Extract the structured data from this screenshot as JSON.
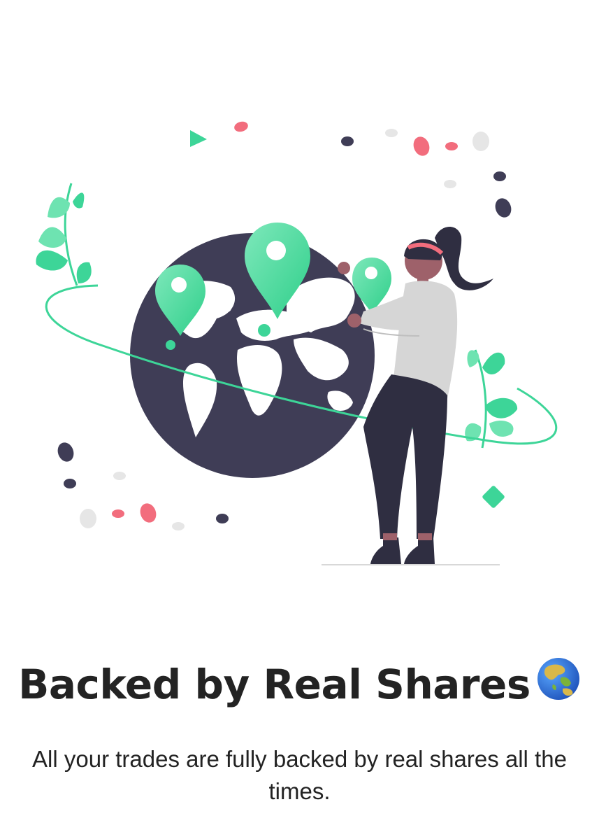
{
  "onboarding": {
    "title": "Backed by Real Shares",
    "title_emoji_icon": "globe-asia-australia-icon",
    "description": "All your trades are fully backed by real shares all the times."
  },
  "illustration": {
    "subject": "woman-placing-map-pins-on-globe",
    "colors": {
      "accent": "#3dd598",
      "accent_light": "#7ee8bb",
      "dark": "#3f3d56",
      "pink": "#f26d7d",
      "gray": "#e6e6e6",
      "sweater": "#d6d6d6",
      "skin": "#9e616a",
      "hair": "#2f2e41"
    }
  }
}
